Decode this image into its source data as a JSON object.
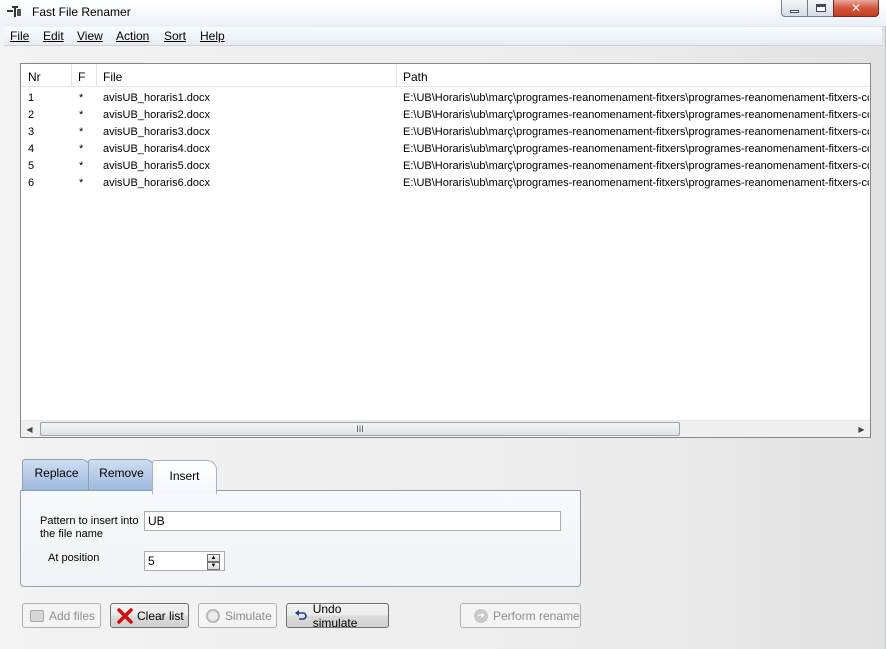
{
  "window": {
    "title": "Fast File Renamer"
  },
  "menu": [
    {
      "label": "File"
    },
    {
      "label": "Edit"
    },
    {
      "label": "View"
    },
    {
      "label": "Action"
    },
    {
      "label": "Sort"
    },
    {
      "label": "Help"
    }
  ],
  "list": {
    "columns": [
      "Nr",
      "F",
      "File",
      "Path"
    ],
    "rows": [
      {
        "nr": "1",
        "f": "*",
        "file": "avisUB_horaris1.docx",
        "path": "E:\\UB\\Horaris\\ub\\març\\programes-reanomenament-fitxers\\programes-reanomenament-fitxers-cca\\"
      },
      {
        "nr": "2",
        "f": "*",
        "file": "avisUB_horaris2.docx",
        "path": "E:\\UB\\Horaris\\ub\\març\\programes-reanomenament-fitxers\\programes-reanomenament-fitxers-cca\\"
      },
      {
        "nr": "3",
        "f": "*",
        "file": "avisUB_horaris3.docx",
        "path": "E:\\UB\\Horaris\\ub\\març\\programes-reanomenament-fitxers\\programes-reanomenament-fitxers-cca\\"
      },
      {
        "nr": "4",
        "f": "*",
        "file": "avisUB_horaris4.docx",
        "path": "E:\\UB\\Horaris\\ub\\març\\programes-reanomenament-fitxers\\programes-reanomenament-fitxers-cca\\"
      },
      {
        "nr": "5",
        "f": "*",
        "file": "avisUB_horaris5.docx",
        "path": "E:\\UB\\Horaris\\ub\\març\\programes-reanomenament-fitxers\\programes-reanomenament-fitxers-cca\\"
      },
      {
        "nr": "6",
        "f": "*",
        "file": "avisUB_horaris6.docx",
        "path": "E:\\UB\\Horaris\\ub\\març\\programes-reanomenament-fitxers\\programes-reanomenament-fitxers-cca\\"
      }
    ],
    "scroll_grip": "III"
  },
  "tabs": [
    {
      "label": "Replace",
      "active": false
    },
    {
      "label": "Remove",
      "active": false
    },
    {
      "label": "Insert",
      "active": true
    }
  ],
  "insert_panel": {
    "pattern_label": "Pattern to insert into the file name",
    "pattern_value": "UB",
    "position_label": "At position",
    "position_value": "5"
  },
  "buttons": {
    "add_files": "Add files",
    "clear_list": "Clear list",
    "simulate": "Simulate",
    "undo_simulate": "Undo simulate",
    "perform_rename": "Perform rename"
  },
  "colors": {
    "tab_inactive": "#9db8dc",
    "close_button": "#c23d22",
    "clear_icon": "#d01010"
  }
}
